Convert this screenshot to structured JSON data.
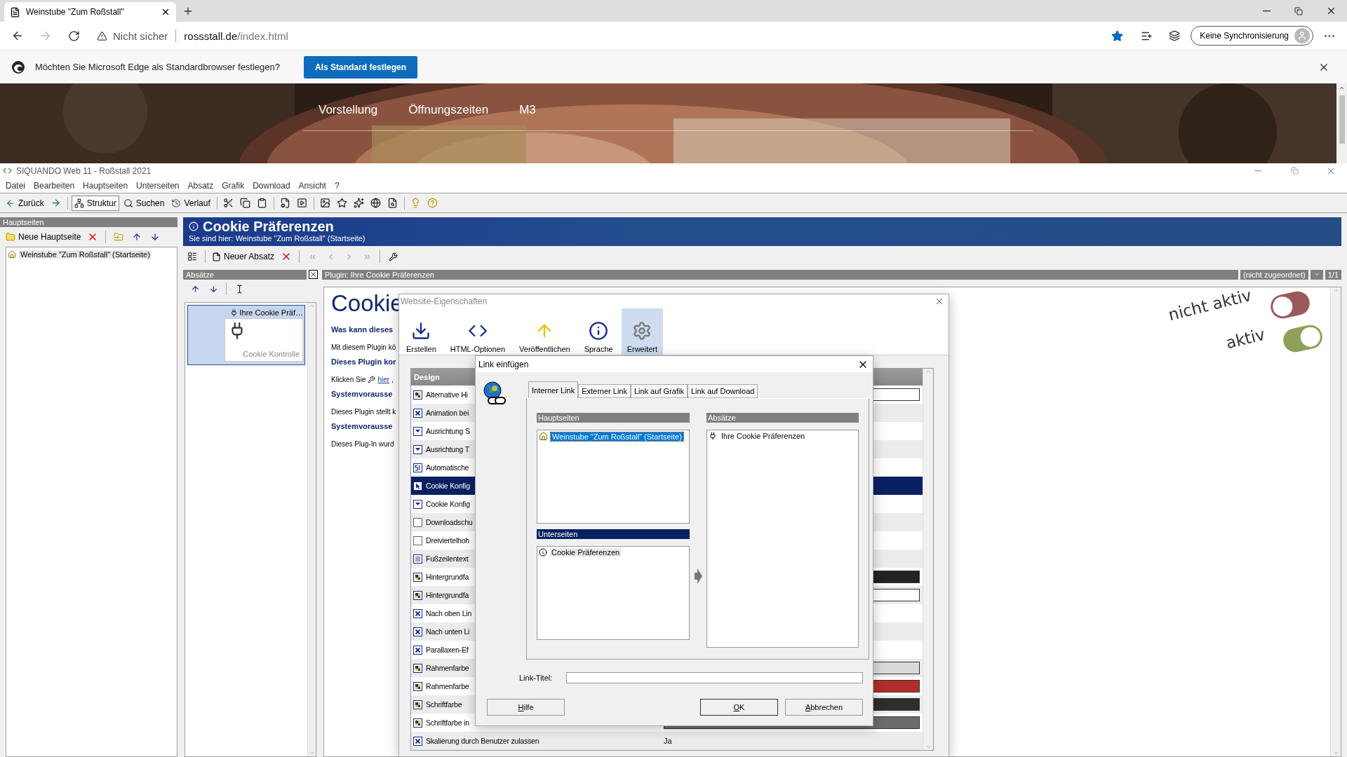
{
  "browser": {
    "tab_title": "Weinstube \"Zum Roßstall\"",
    "security": "Nicht sicher",
    "url_host": "rossstall.de",
    "url_path": "/index.html",
    "sync_button": "Keine Synchronisierung"
  },
  "infobar": {
    "message": "Möchten Sie Microsoft Edge als Standardbrowser festlegen?",
    "button": "Als Standard festlegen"
  },
  "site_nav": [
    "Vorstellung",
    "Öffnungszeiten",
    "M3"
  ],
  "app": {
    "title": "SIQUANDO Web 11 - Roßstall 2021",
    "menu": [
      "Datei",
      "Bearbeiten",
      "Hauptseiten",
      "Unterseiten",
      "Absatz",
      "Grafik",
      "Download",
      "Ansicht",
      "?"
    ],
    "toolbar": [
      {
        "label": "Zurück",
        "selected": false
      },
      {
        "label": "Struktur",
        "selected": true
      },
      {
        "label": "Suchen",
        "selected": false
      },
      {
        "label": "Verlauf",
        "selected": false
      }
    ]
  },
  "main_pages": {
    "header": "Hauptseiten",
    "new_button": "Neue Hauptseite",
    "items": [
      {
        "label": "Weinstube \"Zum Roßstall\" (Startseite)",
        "selected": true
      }
    ]
  },
  "page_header": {
    "title": "Cookie Präferenzen",
    "breadcrumb": "Sie sind hier: Weinstube \"Zum Roßstall\" (Startseite)"
  },
  "page_toolbar": {
    "new_button": "Neuer Absatz"
  },
  "paragraphs": {
    "header": "Absätze",
    "items": [
      {
        "title": "Ihre Cookie Präf…",
        "caption": "Cookie Kontrolle",
        "selected": true
      }
    ]
  },
  "plugin": {
    "header": "Plugin: Ihre Cookie Präferenzen",
    "assignment": "(nicht zugeordnet)",
    "page_count": "1/1",
    "content": [
      {
        "kind": "title",
        "text": "Cookie"
      },
      {
        "kind": "heading",
        "text": "Was kann dieses"
      },
      {
        "kind": "text",
        "text": "Mit diesem Plugin kö"
      },
      {
        "kind": "heading",
        "text": "Dieses Plugin kor"
      },
      {
        "kind": "link",
        "text": "Klicken Sie",
        "link": "hier",
        "after": ","
      },
      {
        "kind": "heading",
        "text": "Systemvorausse"
      },
      {
        "kind": "text",
        "text": "Dieses Plugin stellt k"
      },
      {
        "kind": "heading",
        "text": "Systemvorausse"
      },
      {
        "kind": "text",
        "text": "Dieses Plug-In wurd"
      }
    ],
    "toggles": [
      {
        "label": "nicht aktiv",
        "on": false
      },
      {
        "label": "aktiv",
        "on": true
      }
    ]
  },
  "website_dialog": {
    "title": "Website-Eigenschaften",
    "tabs": [
      {
        "label": "Erstellen",
        "selected": false
      },
      {
        "label": "HTML-Optionen",
        "selected": false
      },
      {
        "label": "Veröffentlichen",
        "selected": false
      },
      {
        "label": "Sprache",
        "selected": false
      },
      {
        "label": "Erweitert",
        "selected": true
      }
    ],
    "list_header": "Design",
    "rows": [
      {
        "label": "Alternative Hi",
        "kind": "color",
        "selected": false,
        "color": "#ffffff"
      },
      {
        "label": "Animation bei",
        "kind": "bool",
        "selected": false
      },
      {
        "label": "Ausrichtung S",
        "kind": "select",
        "selected": false
      },
      {
        "label": "Ausrichtung T",
        "kind": "select",
        "selected": false
      },
      {
        "label": "Automatische",
        "kind": "number",
        "selected": false
      },
      {
        "label": "Cookie Konfig",
        "kind": "pointer",
        "selected": true
      },
      {
        "label": "Cookie Konfig",
        "kind": "select",
        "selected": false
      },
      {
        "label": "Downloadschu",
        "kind": "blank",
        "selected": false
      },
      {
        "label": "Dreiviertelhoh",
        "kind": "blank",
        "selected": false
      },
      {
        "label": "Fußzeilentext",
        "kind": "text",
        "selected": false
      },
      {
        "label": "Hintergrundfa",
        "kind": "color",
        "selected": false,
        "color": "#222222"
      },
      {
        "label": "Hintergrundfa",
        "kind": "color",
        "selected": false,
        "color": "#ffffff"
      },
      {
        "label": "Nach oben Lin",
        "kind": "bool",
        "selected": false
      },
      {
        "label": "Nach unten Li",
        "kind": "bool",
        "selected": false
      },
      {
        "label": "Parallaxen-Ef",
        "kind": "bool",
        "selected": false
      },
      {
        "label": "Rahmenfarbe",
        "kind": "color",
        "selected": false,
        "color": "#d9d9d9"
      },
      {
        "label": "Rahmenfarbe",
        "kind": "color",
        "selected": false,
        "color": "#b32d2d"
      },
      {
        "label": "Schriftfarbe",
        "kind": "color",
        "selected": false,
        "color": "#2e2e2e"
      },
      {
        "label": "Schriftfarbe in",
        "kind": "color",
        "selected": false,
        "color": "#6b6b6b"
      },
      {
        "label": "Skalierung durch Benutzer zulassen",
        "kind": "bool",
        "selected": false,
        "value": "Ja"
      }
    ]
  },
  "link_dialog": {
    "title": "Link einfügen",
    "tabs": [
      {
        "label": "Interner Link",
        "selected": true
      },
      {
        "label": "Externer Link",
        "selected": false
      },
      {
        "label": "Link auf Grafik",
        "selected": false
      },
      {
        "label": "Link auf Download",
        "selected": false
      }
    ],
    "main_pages": {
      "header": "Hauptseiten",
      "header_active": false,
      "focused": true,
      "items": [
        {
          "label": "Weinstube \"Zum Roßstall\" (Startseite)",
          "selected": true
        }
      ]
    },
    "sub_pages": {
      "header": "Unterseiten",
      "header_active": true,
      "focused": false,
      "items": [
        {
          "label": "Cookie Präferenzen",
          "selected": true
        }
      ]
    },
    "paragraphs": {
      "header": "Absätze",
      "header_active": false,
      "items": [
        {
          "label": "Ihre Cookie Präferenzen",
          "selected": false
        }
      ]
    },
    "link_title_label": "Link-Titel:",
    "buttons": [
      "Hilfe",
      "OK",
      "Abbrechen"
    ]
  }
}
